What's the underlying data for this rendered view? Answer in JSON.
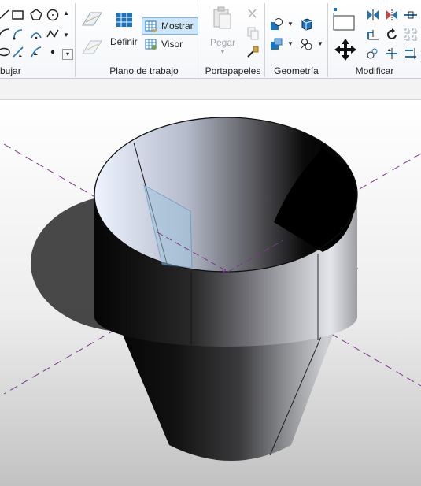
{
  "ribbon": {
    "panels": {
      "dibujar": {
        "label": "bujar"
      },
      "plano": {
        "label": "Plano de trabajo",
        "definir": "Definir",
        "mostrar": "Mostrar",
        "visor": "Visor"
      },
      "portapapeles": {
        "label": "Portapapeles",
        "pegar": "Pegar"
      },
      "geometria": {
        "label": "Geometría"
      },
      "modificar": {
        "label": "Modificar"
      }
    }
  },
  "colors": {
    "accent": "#1e73be",
    "work_plane_fill": "#9fc3dd",
    "reference_line": "#7a3a8c"
  }
}
